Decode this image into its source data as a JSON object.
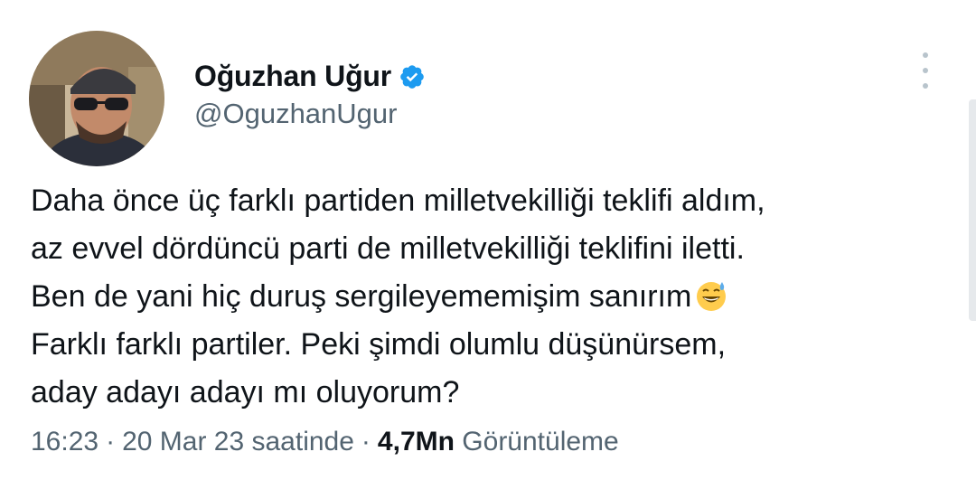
{
  "author": {
    "display_name": "Oğuzhan Uğur",
    "handle": "@OguzhanUgur",
    "verified": true,
    "verified_color": "#1d9bf0"
  },
  "tweet": {
    "lines": [
      "Daha önce üç farklı partiden milletvekilliği teklifi aldım,",
      "az evvel dördüncü parti de milletvekilliği teklifini iletti.",
      "Ben de yani hiç duruş sergileyememişim sanırım",
      "Farklı farklı partiler. Peki şimdi olumlu düşünürsem,",
      "aday adayı adayı mı oluyorum?"
    ],
    "emoji": "grinning-face-with-sweat"
  },
  "meta": {
    "time": "16:23",
    "date": "20 Mar 23 saatinde",
    "separator": "·",
    "views_count": "4,7Mn",
    "views_label": "Görüntüleme"
  },
  "icons": {
    "more": "more-vertical-icon",
    "verified": "verified-badge-icon"
  }
}
